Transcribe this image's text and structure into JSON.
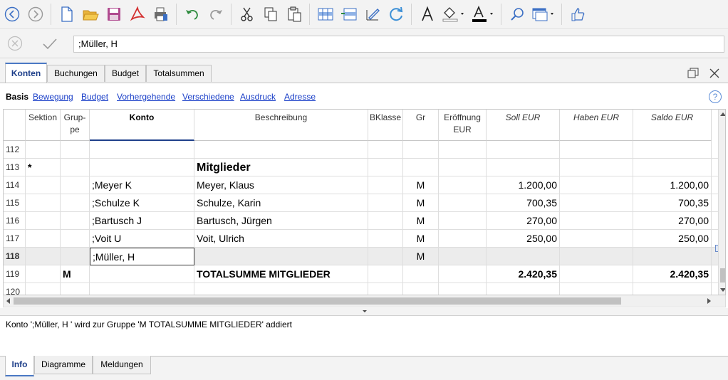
{
  "input_bar": {
    "value": ";Müller, H"
  },
  "tabs": [
    "Konten",
    "Buchungen",
    "Budget",
    "Totalsummen"
  ],
  "views": [
    "Basis",
    "Bewegung",
    "Budget",
    "Vorhergehende",
    "Verschiedene",
    "Ausdruck",
    "Adresse"
  ],
  "help_label": "?",
  "columns": {
    "sektion": "Sektion",
    "gruppe": "Grup-pe",
    "konto": "Konto",
    "beschreibung": "Beschreibung",
    "bklasse": "BKlasse",
    "gr": "Gr",
    "eroeffnung": "Eröffnung EUR",
    "soll": "Soll EUR",
    "haben": "Haben EUR",
    "saldo": "Saldo EUR"
  },
  "rows": [
    {
      "num": "112",
      "sektion": "",
      "gruppe": "",
      "konto": "",
      "beschreibung": "",
      "gr": "",
      "soll": "",
      "saldo": ""
    },
    {
      "num": "113",
      "sektion": "*",
      "gruppe": "",
      "konto": "",
      "beschreibung": "Mitglieder",
      "gr": "",
      "soll": "",
      "saldo": ""
    },
    {
      "num": "114",
      "sektion": "",
      "gruppe": "",
      "konto": ";Meyer K",
      "beschreibung": "Meyer, Klaus",
      "gr": "M",
      "soll": "1.200,00",
      "saldo": "1.200,00"
    },
    {
      "num": "115",
      "sektion": "",
      "gruppe": "",
      "konto": ";Schulze K",
      "beschreibung": "Schulze, Karin",
      "gr": "M",
      "soll": "700,35",
      "saldo": "700,35"
    },
    {
      "num": "116",
      "sektion": "",
      "gruppe": "",
      "konto": ";Bartusch J",
      "beschreibung": "Bartusch, Jürgen",
      "gr": "M",
      "soll": "270,00",
      "saldo": "270,00"
    },
    {
      "num": "117",
      "sektion": "",
      "gruppe": "",
      "konto": ";Voit U",
      "beschreibung": "Voit, Ulrich",
      "gr": "M",
      "soll": "250,00",
      "saldo": "250,00"
    },
    {
      "num": "118",
      "sektion": "",
      "gruppe": "",
      "konto": ";Müller, H",
      "beschreibung": "",
      "gr": "M",
      "soll": "",
      "saldo": ""
    },
    {
      "num": "119",
      "sektion": "",
      "gruppe": "M",
      "konto": "",
      "beschreibung": "TOTALSUMME MITGLIEDER",
      "gr": "",
      "soll": "2.420,35",
      "saldo": "2.420,35"
    },
    {
      "num": "120",
      "sektion": "",
      "gruppe": "",
      "konto": "",
      "beschreibung": "",
      "gr": "",
      "soll": "",
      "saldo": ""
    }
  ],
  "info_message": "Konto ';Müller, H ' wird zur Gruppe 'M TOTALSUMME MITGLIEDER' addiert",
  "bottom_tabs": [
    "Info",
    "Diagramme",
    "Meldungen"
  ]
}
